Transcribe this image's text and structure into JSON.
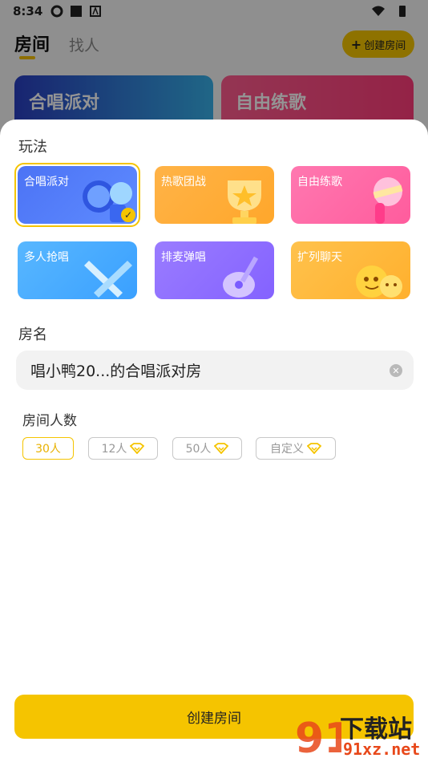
{
  "status_bar": {
    "time": "8:34"
  },
  "top_nav": {
    "tab_rooms": "房间",
    "tab_people": "找人",
    "create_room": "创建房间"
  },
  "banners": [
    {
      "label": "合唱派对"
    },
    {
      "label": "自由练歌"
    }
  ],
  "sheet": {
    "mode_title": "玩法",
    "modes": [
      {
        "label": "合唱派对",
        "selected": true
      },
      {
        "label": "热歌团战",
        "selected": false
      },
      {
        "label": "自由练歌",
        "selected": false
      },
      {
        "label": "多人抢唱",
        "selected": false
      },
      {
        "label": "排麦弹唱",
        "selected": false
      },
      {
        "label": "扩列聊天",
        "selected": false
      }
    ],
    "name_title": "房名",
    "room_name_value": "唱小鸭20...的合唱派对房",
    "count_title": "房间人数",
    "count_options": [
      {
        "label": "30人",
        "selected": true,
        "premium": false
      },
      {
        "label": "12人",
        "selected": false,
        "premium": true
      },
      {
        "label": "50人",
        "selected": false,
        "premium": true
      },
      {
        "label": "自定义",
        "selected": false,
        "premium": true
      }
    ],
    "create_button": "创建房间"
  },
  "watermark": {
    "text_cn": "下载站",
    "url": "91xz.net",
    "logo_number": "91"
  },
  "colors": {
    "accent": "#f5c400",
    "sheet_bg": "#ffffff",
    "field_bg": "#f2f2f2"
  }
}
